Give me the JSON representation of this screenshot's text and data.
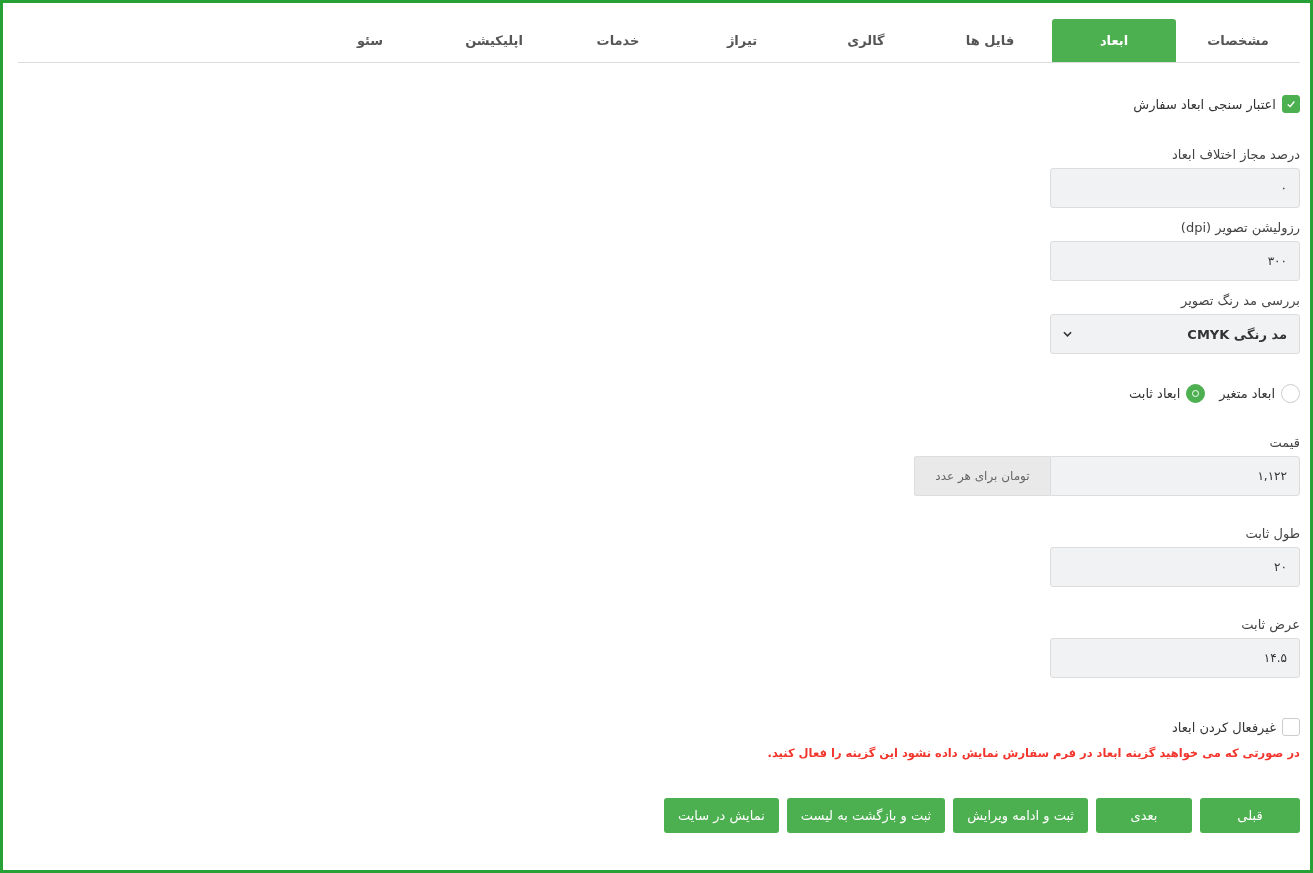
{
  "tabs": [
    {
      "label": "مشخصات",
      "selected": false
    },
    {
      "label": "ابعاد",
      "selected": true
    },
    {
      "label": "فایل ها",
      "selected": false
    },
    {
      "label": "گالری",
      "selected": false
    },
    {
      "label": "تیراژ",
      "selected": false
    },
    {
      "label": "خدمات",
      "selected": false
    },
    {
      "label": "اپلیکیشن",
      "selected": false
    },
    {
      "label": "سئو",
      "selected": false
    }
  ],
  "form": [
    {
      "kind": "checkbox",
      "label": "اعتبار سنجی ابعاد سفارش",
      "checked": true
    },
    {
      "kind": "input",
      "label": "درصد مجاز اختلاف ابعاد",
      "value": "۰"
    },
    {
      "kind": "input",
      "label": "رزولیشن تصویر (dpi)",
      "value": "۳۰۰"
    },
    {
      "kind": "select",
      "label": "بررسی مد رنگ تصویر",
      "value": "مد رنگی CMYK"
    },
    {
      "kind": "radio",
      "options": [
        {
          "label": "ابعاد متغیر",
          "selected": false
        },
        {
          "label": "ابعاد ثابت",
          "selected": true
        }
      ]
    },
    {
      "kind": "addon",
      "label": "قیمت",
      "value": "۱,۱۲۲",
      "addon": "تومان برای هر عدد"
    },
    {
      "kind": "input",
      "label": "طول ثابت",
      "value": "۲۰"
    },
    {
      "kind": "input",
      "label": "عرض ثابت",
      "value": "۱۴.۵"
    },
    {
      "kind": "checkbox",
      "label": "غیرفعال کردن ابعاد",
      "checked": false,
      "note": "در صورتی که می خواهید گزینه ابعاد در فرم سفارش نمایش داده نشود این گزینه را فعال کنید."
    }
  ],
  "buttons": [
    "قبلی",
    "بعدی",
    "ثبت و ادامه ویرایش",
    "ثبت و بازگشت به لیست",
    "نمایش در سایت"
  ]
}
